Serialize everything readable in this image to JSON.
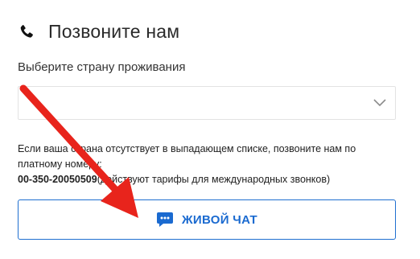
{
  "header": {
    "title": "Позвоните нам",
    "icon": "phone-icon"
  },
  "country": {
    "label": "Выберите страну проживания",
    "selected_value": "",
    "chevron_icon": "chevron-down-icon"
  },
  "info": {
    "line1": "Если ваша страна отсутствует в выпадающем списке, позвоните нам по",
    "line2": "платному номеру:",
    "phone_number": "00-350-20050509",
    "rates_note": "(действуют тарифы для международных звонков)"
  },
  "chat_button": {
    "label": "ЖИВОЙ ЧАТ",
    "icon": "chat-bubble-icon"
  },
  "annotation": {
    "arrow_icon": "red-arrow-icon",
    "color": "#e8241c"
  },
  "colors": {
    "accent": "#1a6ad0",
    "text": "#222222",
    "border": "#e3e3e3"
  }
}
